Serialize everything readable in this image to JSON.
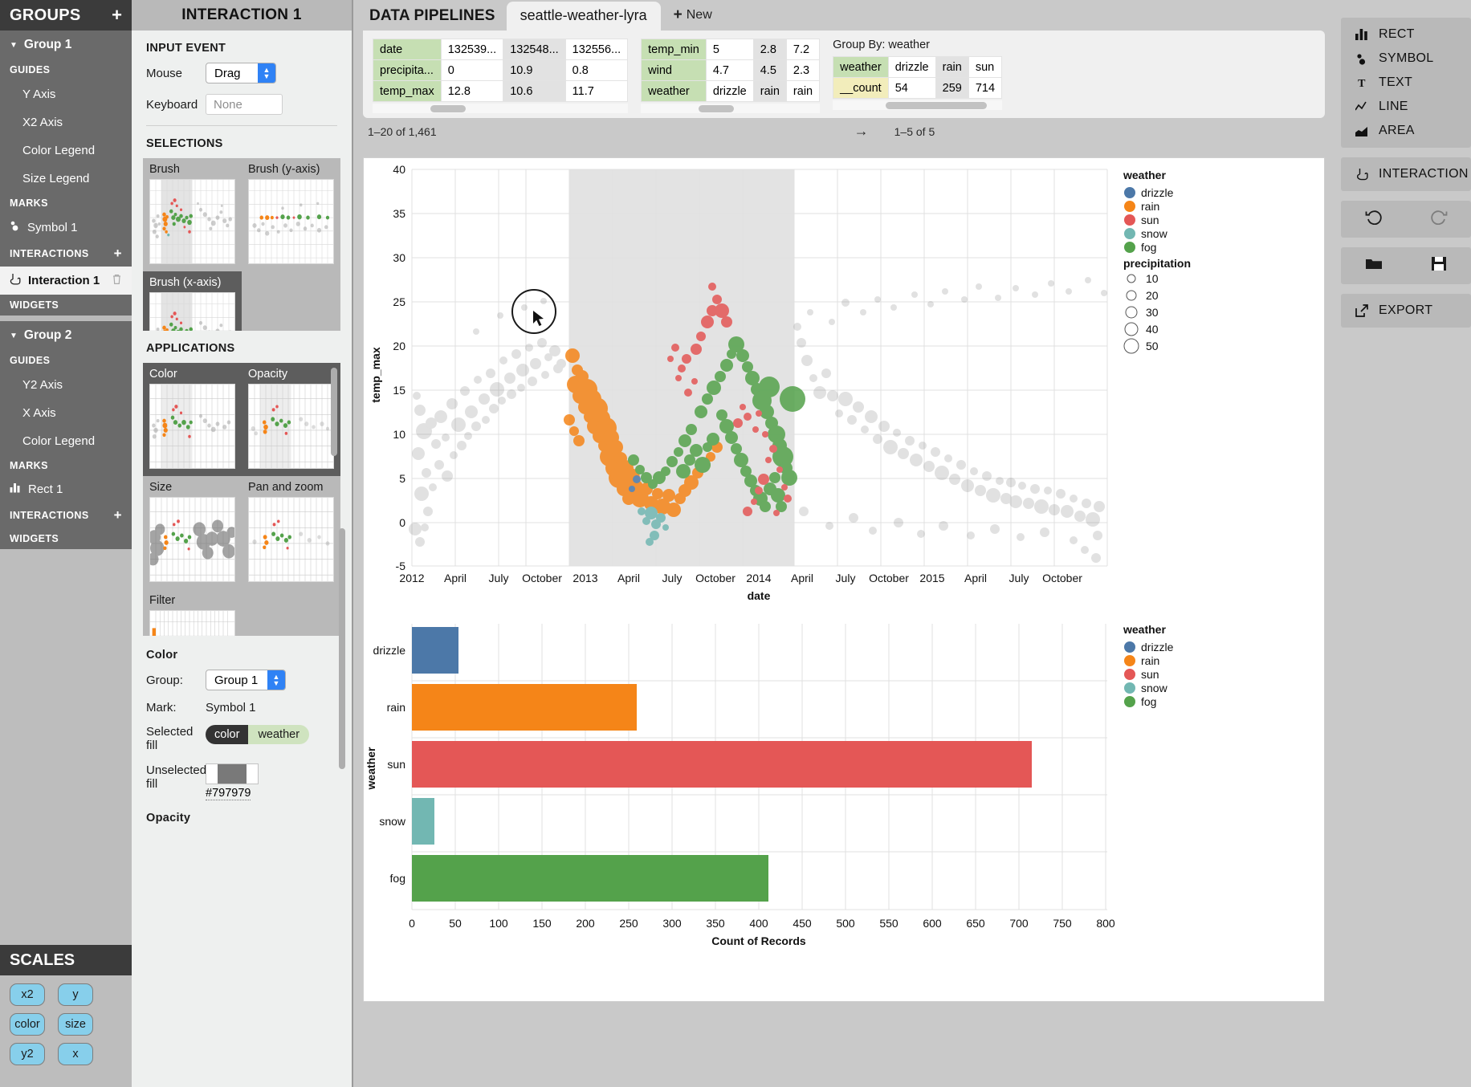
{
  "sidebar": {
    "header": {
      "title": "GROUPS",
      "add": "+"
    },
    "groups": [
      {
        "name": "Group 1",
        "guides_label": "GUIDES",
        "guides": [
          "Y Axis",
          "X2 Axis",
          "Color Legend",
          "Size Legend"
        ],
        "marks_label": "MARKS",
        "marks": [
          {
            "label": "Symbol 1",
            "icon": "symbol-icon"
          }
        ],
        "interactions_label": "INTERACTIONS",
        "interactions": [
          {
            "label": "Interaction 1",
            "icon": "interaction-icon",
            "selected": true
          }
        ],
        "widgets_label": "WIDGETS"
      },
      {
        "name": "Group 2",
        "guides_label": "GUIDES",
        "guides": [
          "Y2 Axis",
          "X Axis",
          "Color Legend"
        ],
        "marks_label": "MARKS",
        "marks": [
          {
            "label": "Rect 1",
            "icon": "rect-icon"
          }
        ],
        "interactions_label": "INTERACTIONS",
        "interactions": [],
        "widgets_label": "WIDGETS"
      }
    ],
    "scales": {
      "title": "SCALES",
      "pills": [
        "x2",
        "y",
        "color",
        "size",
        "y2",
        "x"
      ]
    }
  },
  "inspector": {
    "title": "INTERACTION 1",
    "input_event": {
      "heading": "INPUT EVENT",
      "mouse_label": "Mouse",
      "mouse_value": "Drag",
      "keyboard_label": "Keyboard",
      "keyboard_placeholder": "None"
    },
    "selections": {
      "heading": "SELECTIONS",
      "tiles": [
        {
          "label": "Brush",
          "selected": false
        },
        {
          "label": "Brush (y-axis)",
          "selected": false
        },
        {
          "label": "Brush (x-axis)",
          "selected": true
        }
      ]
    },
    "applications": {
      "heading": "APPLICATIONS",
      "tiles": [
        {
          "label": "Color",
          "selected": true
        },
        {
          "label": "Opacity",
          "selected": false
        },
        {
          "label": "Size",
          "selected": false
        },
        {
          "label": "Pan and zoom",
          "selected": false
        },
        {
          "label": "Filter",
          "selected": false
        }
      ]
    },
    "color_props": {
      "heading": "Color",
      "group_label": "Group:",
      "group_value": "Group 1",
      "mark_label": "Mark:",
      "mark_value": "Symbol 1",
      "selected_fill_label": "Selected fill",
      "selected_fill_key": "color",
      "selected_fill_value": "weather",
      "unselected_fill_label": "Unselected fill",
      "unselected_fill_hex": "#797979"
    },
    "opacity_heading": "Opacity"
  },
  "pipelines": {
    "title": "DATA PIPELINES",
    "active_tab": "seattle-weather-lyra",
    "new_tab": "New",
    "table_left": {
      "rows": [
        {
          "key": "date",
          "values": [
            "132539...",
            "132548...",
            "132556..."
          ]
        },
        {
          "key": "precipita...",
          "values": [
            "0",
            "10.9",
            "0.8"
          ]
        },
        {
          "key": "temp_max",
          "values": [
            "12.8",
            "10.6",
            "11.7"
          ]
        }
      ]
    },
    "table_mid": {
      "rows": [
        {
          "key": "temp_min",
          "values": [
            "5",
            "2.8",
            "7.2"
          ]
        },
        {
          "key": "wind",
          "values": [
            "4.7",
            "4.5",
            "2.3"
          ]
        },
        {
          "key": "weather",
          "values": [
            "drizzle",
            "rain",
            "rain"
          ]
        }
      ]
    },
    "group_by": {
      "title": "Group By: weather",
      "rows": [
        {
          "key": "weather",
          "values": [
            "drizzle",
            "rain",
            "sun"
          ]
        },
        {
          "key": "__count",
          "values": [
            "54",
            "259",
            "714"
          ]
        }
      ]
    },
    "footer_left": "1–20 of 1,461",
    "footer_right": "1–5 of 5",
    "next_arrow": "→"
  },
  "toolbar": {
    "marks": [
      {
        "label": "RECT",
        "icon": "rect-icon"
      },
      {
        "label": "SYMBOL",
        "icon": "symbol-icon"
      },
      {
        "label": "TEXT",
        "icon": "text-icon"
      },
      {
        "label": "LINE",
        "icon": "line-icon"
      },
      {
        "label": "AREA",
        "icon": "area-icon"
      }
    ],
    "interaction": {
      "label": "INTERACTION",
      "icon": "interaction-icon"
    },
    "undo": "undo-icon",
    "redo": "redo-icon",
    "open": "folder-icon",
    "save": "save-icon",
    "export": {
      "label": "EXPORT",
      "icon": "export-icon"
    }
  },
  "chart_data": [
    {
      "type": "scatter",
      "title": "",
      "xlabel": "date",
      "ylabel": "temp_max",
      "ylim": [
        -5,
        40
      ],
      "yticks": [
        -5,
        0,
        5,
        10,
        15,
        20,
        25,
        30,
        35,
        40
      ],
      "xticks": [
        "2012",
        "April",
        "July",
        "October",
        "2013",
        "April",
        "July",
        "October",
        "2014",
        "April",
        "July",
        "October",
        "2015",
        "April",
        "July",
        "October"
      ],
      "grid": true,
      "brush_range": [
        "2012-10",
        "2014-02"
      ],
      "legend_position": "right",
      "legends": [
        {
          "title": "weather",
          "type": "color",
          "entries": [
            {
              "label": "drizzle",
              "color": "#4c78a8"
            },
            {
              "label": "rain",
              "color": "#f58518"
            },
            {
              "label": "sun",
              "color": "#e45756"
            },
            {
              "label": "snow",
              "color": "#72b7b2"
            },
            {
              "label": "fog",
              "color": "#54a24b"
            }
          ]
        },
        {
          "title": "precipitation",
          "type": "size",
          "entries": [
            {
              "label": "10",
              "r": 4
            },
            {
              "label": "20",
              "r": 6
            },
            {
              "label": "30",
              "r": 7.5
            },
            {
              "label": "40",
              "r": 9
            },
            {
              "label": "50",
              "r": 10.5
            }
          ]
        }
      ],
      "unselected_color": "#797979"
    },
    {
      "type": "bar",
      "orientation": "horizontal",
      "title": "",
      "xlabel": "Count of Records",
      "ylabel": "weather",
      "categories": [
        "drizzle",
        "rain",
        "sun",
        "snow",
        "fog"
      ],
      "values": [
        54,
        259,
        714,
        26,
        411
      ],
      "colors": [
        "#4c78a8",
        "#f58518",
        "#e45756",
        "#72b7b2",
        "#54a24b"
      ],
      "xlim": [
        0,
        800
      ],
      "xticks": [
        0,
        50,
        100,
        150,
        200,
        250,
        300,
        350,
        400,
        450,
        500,
        550,
        600,
        650,
        700,
        750,
        800
      ],
      "grid": true,
      "legend_position": "right",
      "legends": [
        {
          "title": "weather",
          "type": "color",
          "entries": [
            {
              "label": "drizzle",
              "color": "#4c78a8"
            },
            {
              "label": "rain",
              "color": "#f58518"
            },
            {
              "label": "sun",
              "color": "#e45756"
            },
            {
              "label": "snow",
              "color": "#72b7b2"
            },
            {
              "label": "fog",
              "color": "#54a24b"
            }
          ]
        }
      ]
    }
  ]
}
